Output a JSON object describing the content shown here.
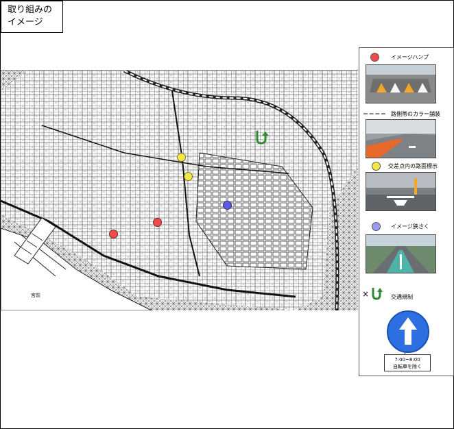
{
  "title": {
    "line1": "取り組みの",
    "line2": "イメージ"
  },
  "colors": {
    "hump_red": "#ef4b4b",
    "crosswalk_yellow": "#f2e84a",
    "image_blue": "#5a5ae6",
    "sign_blue": "#2d6ee0",
    "arrow_green": "#2e8b2e"
  },
  "legend": {
    "items": [
      {
        "label": "イメージハンプ",
        "marker": "red-circle"
      },
      {
        "label": "路側帯のカラー舗装",
        "marker": "dashed-line"
      },
      {
        "label": "交差点内の路面標示",
        "marker": "yellow-circle"
      },
      {
        "label": "イメージ狭さく",
        "marker": "blue-circle"
      },
      {
        "label": "交通規制",
        "marker": "no-turn-arrow"
      }
    ],
    "sign_plate": {
      "line1": "7:00~8:00",
      "line2": "自転車を除く"
    }
  },
  "map": {
    "landmark": "宮前",
    "markers": [
      {
        "kind": "hump",
        "color": "#ef4b4b"
      },
      {
        "kind": "hump",
        "color": "#ef4b4b"
      },
      {
        "kind": "crosswalk",
        "color": "#f2e84a"
      },
      {
        "kind": "crosswalk",
        "color": "#f2e84a"
      },
      {
        "kind": "narrowing",
        "color": "#5a5ae6"
      },
      {
        "kind": "regulation",
        "color": "#2e8b2e"
      }
    ]
  }
}
